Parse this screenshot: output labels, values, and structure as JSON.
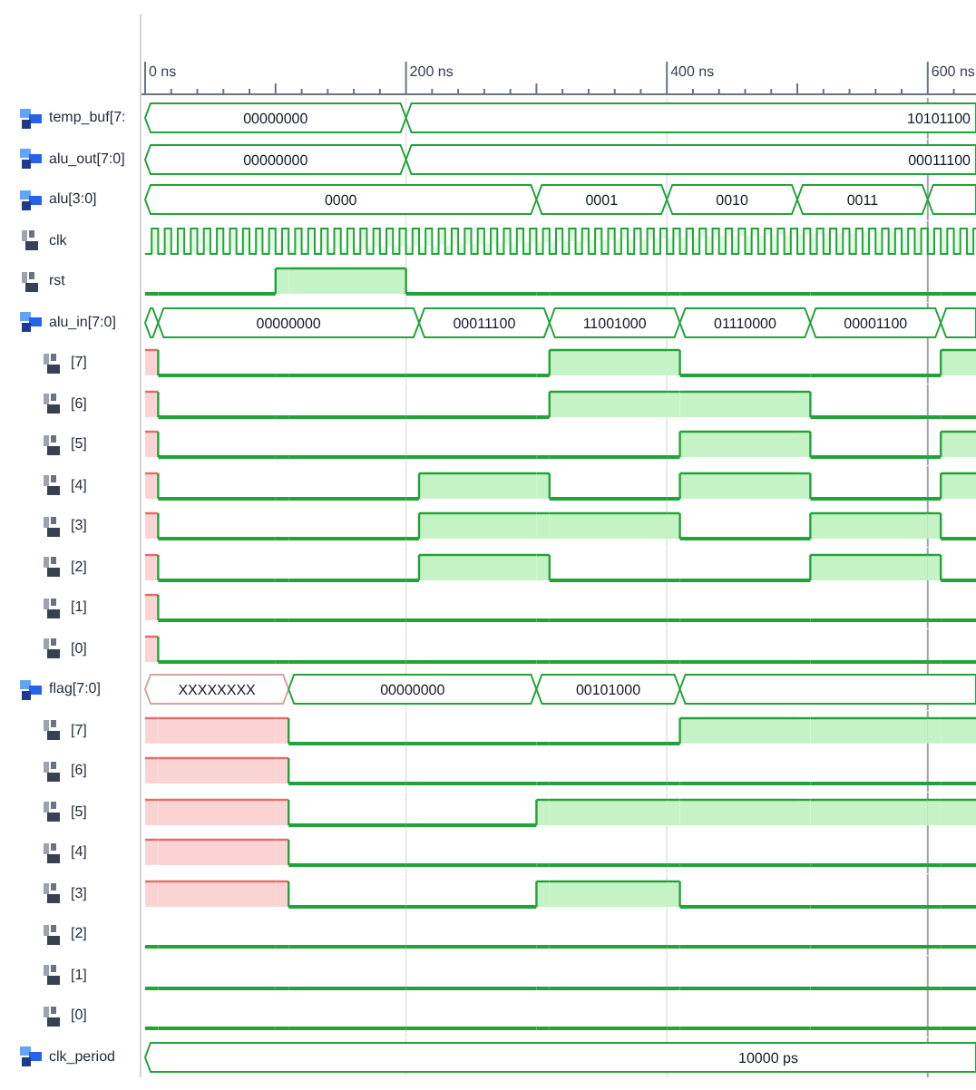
{
  "ruler": {
    "ticks": [
      "0 ns",
      "200 ns",
      "400 ns",
      "600 ns"
    ]
  },
  "signals": [
    {
      "name": "temp_buf[7:",
      "kind": "bus",
      "segments": [
        {
          "kind": "value",
          "value": "00000000"
        },
        {
          "kind": "value",
          "value": "10101100"
        }
      ]
    },
    {
      "name": "alu_out[7:0]",
      "kind": "bus",
      "segments": [
        {
          "kind": "value",
          "value": "00000000"
        },
        {
          "kind": "value",
          "value": "00011100"
        }
      ]
    },
    {
      "name": "alu[3:0]",
      "kind": "bus",
      "segments": [
        {
          "kind": "value",
          "value": "0000"
        },
        {
          "kind": "value",
          "value": "0001"
        },
        {
          "kind": "value",
          "value": "0010"
        },
        {
          "kind": "value",
          "value": "0011"
        },
        {
          "kind": "blank"
        }
      ]
    },
    {
      "name": "clk",
      "kind": "clock"
    },
    {
      "name": "rst",
      "kind": "bit",
      "high": [
        false,
        false,
        true,
        true,
        false,
        false,
        false,
        false,
        false,
        false,
        false,
        false,
        false,
        false
      ]
    },
    {
      "name": "alu_in[7:0]",
      "kind": "bus",
      "segments": [
        {
          "kind": "blank"
        },
        {
          "kind": "value",
          "value": "00000000"
        },
        {
          "kind": "value",
          "value": "00011100"
        },
        {
          "kind": "value",
          "value": "11001000"
        },
        {
          "kind": "value",
          "value": "01110000"
        },
        {
          "kind": "value",
          "value": "00001100"
        },
        {
          "kind": "blank"
        }
      ],
      "children": [
        {
          "name": "[7]",
          "kind": "bit",
          "unknown": [
            true,
            false,
            false,
            false,
            false,
            false,
            false,
            false,
            false,
            false,
            false,
            false,
            false,
            false
          ],
          "high": [
            false,
            false,
            false,
            false,
            false,
            false,
            false,
            true,
            true,
            false,
            false,
            false,
            false,
            true
          ]
        },
        {
          "name": "[6]",
          "kind": "bit",
          "unknown": [
            true,
            false,
            false,
            false,
            false,
            false,
            false,
            false,
            false,
            false,
            false,
            false,
            false,
            false
          ],
          "high": [
            false,
            false,
            false,
            false,
            false,
            false,
            false,
            true,
            true,
            true,
            true,
            false,
            false,
            false
          ]
        },
        {
          "name": "[5]",
          "kind": "bit",
          "unknown": [
            true,
            false,
            false,
            false,
            false,
            false,
            false,
            false,
            false,
            false,
            false,
            false,
            false,
            false
          ],
          "high": [
            false,
            false,
            false,
            false,
            false,
            false,
            false,
            false,
            false,
            true,
            true,
            false,
            false,
            true
          ]
        },
        {
          "name": "[4]",
          "kind": "bit",
          "unknown": [
            true,
            false,
            false,
            false,
            false,
            false,
            false,
            false,
            false,
            false,
            false,
            false,
            false,
            false
          ],
          "high": [
            false,
            false,
            false,
            false,
            false,
            true,
            true,
            false,
            false,
            true,
            true,
            false,
            false,
            true
          ]
        },
        {
          "name": "[3]",
          "kind": "bit",
          "unknown": [
            true,
            false,
            false,
            false,
            false,
            false,
            false,
            false,
            false,
            false,
            false,
            false,
            false,
            false
          ],
          "high": [
            false,
            false,
            false,
            false,
            false,
            true,
            true,
            true,
            true,
            false,
            false,
            true,
            true,
            false
          ]
        },
        {
          "name": "[2]",
          "kind": "bit",
          "unknown": [
            true,
            false,
            false,
            false,
            false,
            false,
            false,
            false,
            false,
            false,
            false,
            false,
            false,
            false
          ],
          "high": [
            false,
            false,
            false,
            false,
            false,
            true,
            true,
            false,
            false,
            false,
            false,
            true,
            true,
            false
          ]
        },
        {
          "name": "[1]",
          "kind": "bit",
          "unknown": [
            true,
            false,
            false,
            false,
            false,
            false,
            false,
            false,
            false,
            false,
            false,
            false,
            false,
            false
          ],
          "high": [
            false,
            false,
            false,
            false,
            false,
            false,
            false,
            false,
            false,
            false,
            false,
            false,
            false,
            false
          ]
        },
        {
          "name": "[0]",
          "kind": "bit",
          "unknown": [
            true,
            false,
            false,
            false,
            false,
            false,
            false,
            false,
            false,
            false,
            false,
            false,
            false,
            false
          ],
          "high": [
            false,
            false,
            false,
            false,
            false,
            false,
            false,
            false,
            false,
            false,
            false,
            false,
            false,
            false
          ]
        }
      ]
    },
    {
      "name": "flag[7:0]",
      "kind": "bus",
      "segments": [
        {
          "kind": "unknown",
          "value": "XXXXXXXX"
        },
        {
          "kind": "value",
          "value": "00000000"
        },
        {
          "kind": "value",
          "value": "00101000"
        },
        {
          "kind": "blank"
        }
      ],
      "children": [
        {
          "name": "[7]",
          "kind": "bit",
          "unknown": [
            true,
            true,
            true,
            false,
            false,
            false,
            false,
            false,
            false,
            false,
            false,
            false,
            false,
            false
          ],
          "high": [
            false,
            false,
            false,
            false,
            false,
            false,
            false,
            false,
            false,
            true,
            true,
            true,
            true,
            true
          ]
        },
        {
          "name": "[6]",
          "kind": "bit",
          "unknown": [
            true,
            true,
            true,
            false,
            false,
            false,
            false,
            false,
            false,
            false,
            false,
            false,
            false,
            false
          ],
          "high": [
            false,
            false,
            false,
            false,
            false,
            false,
            false,
            false,
            false,
            false,
            false,
            false,
            false,
            false
          ]
        },
        {
          "name": "[5]",
          "kind": "bit",
          "unknown": [
            true,
            true,
            true,
            false,
            false,
            false,
            false,
            false,
            false,
            false,
            false,
            false,
            false,
            false
          ],
          "high": [
            false,
            false,
            false,
            false,
            false,
            false,
            true,
            true,
            true,
            true,
            true,
            true,
            true,
            true
          ]
        },
        {
          "name": "[4]",
          "kind": "bit",
          "unknown": [
            true,
            true,
            true,
            false,
            false,
            false,
            false,
            false,
            false,
            false,
            false,
            false,
            false,
            false
          ],
          "high": [
            false,
            false,
            false,
            false,
            false,
            false,
            false,
            false,
            false,
            false,
            false,
            false,
            false,
            false
          ]
        },
        {
          "name": "[3]",
          "kind": "bit",
          "unknown": [
            true,
            true,
            true,
            false,
            false,
            false,
            false,
            false,
            false,
            false,
            false,
            false,
            false,
            false
          ],
          "high": [
            false,
            false,
            false,
            false,
            false,
            false,
            true,
            true,
            true,
            false,
            false,
            false,
            false,
            false
          ]
        },
        {
          "name": "[2]",
          "kind": "bit",
          "high": [
            false,
            false,
            false,
            false,
            false,
            false,
            false,
            false,
            false,
            false,
            false,
            false,
            false,
            false
          ]
        },
        {
          "name": "[1]",
          "kind": "bit",
          "high": [
            false,
            false,
            false,
            false,
            false,
            false,
            false,
            false,
            false,
            false,
            false,
            false,
            false,
            false
          ]
        },
        {
          "name": "[0]",
          "kind": "bit",
          "high": [
            false,
            false,
            false,
            false,
            false,
            false,
            false,
            false,
            false,
            false,
            false,
            false,
            false,
            false
          ]
        }
      ]
    },
    {
      "name": "clk_period",
      "kind": "bus",
      "segments": [
        {
          "kind": "value",
          "value": "10000 ps"
        }
      ]
    }
  ]
}
